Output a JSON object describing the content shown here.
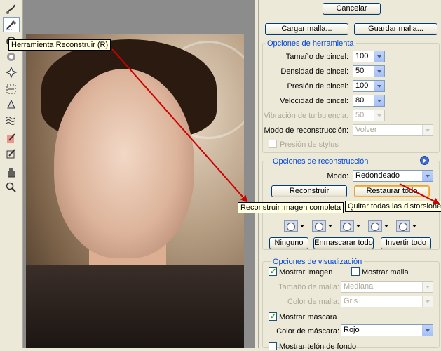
{
  "toolbar": {
    "tools": [
      "warp-icon",
      "reconstruct-icon",
      "twirl-icon",
      "pucker-icon",
      "bloat-icon",
      "push-left-icon",
      "mirror-icon",
      "turbulence-icon",
      "freeze-mask-icon",
      "thaw-mask-icon",
      "hand-icon",
      "zoom-icon"
    ],
    "tooltip": "Herramienta Reconstruir (R)"
  },
  "buttons": {
    "cancel": "Cancelar",
    "load_mesh": "Cargar malla...",
    "save_mesh": "Guardar malla..."
  },
  "tool_options": {
    "legend": "Opciones de herramienta",
    "brush_size_label": "Tamaño de pincel:",
    "brush_size": "100",
    "brush_density_label": "Densidad de pincel:",
    "brush_density": "50",
    "brush_pressure_label": "Presión de pincel:",
    "brush_pressure": "100",
    "brush_rate_label": "Velocidad de pincel:",
    "brush_rate": "80",
    "turbulent_jitter_label": "Vibración de turbulencia:",
    "turbulent_jitter": "50",
    "reconstruct_mode_label": "Modo de reconstrucción:",
    "reconstruct_mode": "Volver",
    "stylus_pressure_label": "Presión de stylus"
  },
  "reconstruct_options": {
    "legend": "Opciones de reconstrucción",
    "mode_label": "Modo:",
    "mode": "Redondeado",
    "reconstruct_button": "Reconstruir",
    "restore_all_button": "Restaurar todo",
    "reconstruct_tooltip": "Reconstruir imagen completa",
    "restore_tooltip": "Quitar todas las distorsiones"
  },
  "mask_options": {
    "none_button": "Ninguno",
    "mask_all_button": "Enmascarar todo",
    "invert_all_button": "Invertir todo"
  },
  "view_options": {
    "legend": "Opciones de visualización",
    "show_image_label": "Mostrar imagen",
    "show_image": true,
    "show_mesh_label": "Mostrar malla",
    "show_mesh": false,
    "mesh_size_label": "Tamaño de malla:",
    "mesh_size": "Mediana",
    "mesh_color_label": "Color de malla:",
    "mesh_color": "Gris",
    "show_mask_label": "Mostrar máscara",
    "show_mask": true,
    "mask_color_label": "Color de máscara:",
    "mask_color": "Rojo",
    "show_backdrop_label": "Mostrar telón de fondo",
    "show_backdrop": false
  },
  "colors": {
    "arrow": "#cc0000",
    "legend": "#0046d5",
    "panel_bg": "#ece9d8"
  }
}
